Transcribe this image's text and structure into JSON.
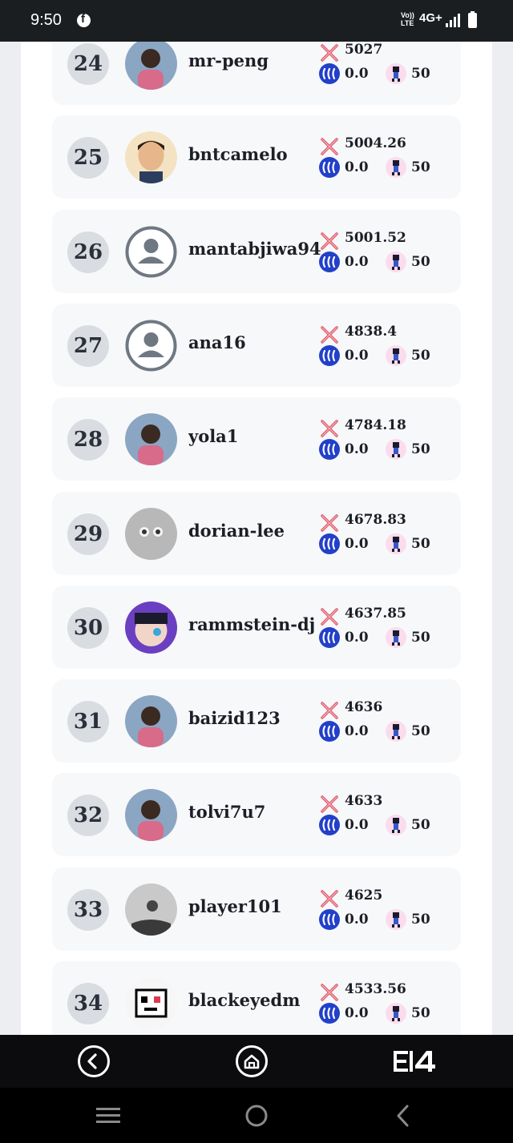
{
  "status_bar": {
    "time": "9:50",
    "volte_line1": "Vo))",
    "volte_line2": "LTE",
    "network": "4G+",
    "icons": [
      "facebook-icon",
      "signal-icon",
      "battery-icon"
    ]
  },
  "colors": {
    "rank_badge": "#d9dce1",
    "steem_icon": "#2340c9",
    "swords_icon": "#e05a6a",
    "card_bg": "#f7f8fa"
  },
  "leaderboard": [
    {
      "rank": "24",
      "username": "mr-peng",
      "score": "5027",
      "steem": "0.0",
      "level": "50",
      "avatar": "photo"
    },
    {
      "rank": "25",
      "username": "bntcamelo",
      "score": "5004.26",
      "steem": "0.0",
      "level": "50",
      "avatar": "cartoon"
    },
    {
      "rank": "26",
      "username": "mantabjiwa94",
      "score": "5001.52",
      "steem": "0.0",
      "level": "50",
      "avatar": "default"
    },
    {
      "rank": "27",
      "username": "ana16",
      "score": "4838.4",
      "steem": "0.0",
      "level": "50",
      "avatar": "default"
    },
    {
      "rank": "28",
      "username": "yola1",
      "score": "4784.18",
      "steem": "0.0",
      "level": "50",
      "avatar": "photo"
    },
    {
      "rank": "29",
      "username": "dorian-lee",
      "score": "4678.83",
      "steem": "0.0",
      "level": "50",
      "avatar": "cat"
    },
    {
      "rank": "30",
      "username": "rammstein-dj",
      "score": "4637.85",
      "steem": "0.0",
      "level": "50",
      "avatar": "anime"
    },
    {
      "rank": "31",
      "username": "baizid123",
      "score": "4636",
      "steem": "0.0",
      "level": "50",
      "avatar": "photo"
    },
    {
      "rank": "32",
      "username": "tolvi7u7",
      "score": "4633",
      "steem": "0.0",
      "level": "50",
      "avatar": "photo"
    },
    {
      "rank": "33",
      "username": "player101",
      "score": "4625",
      "steem": "0.0",
      "level": "50",
      "avatar": "photo-bw"
    },
    {
      "rank": "34",
      "username": "blackeyedm",
      "score": "4533.56",
      "steem": "0.0",
      "level": "50",
      "avatar": "pixel"
    }
  ],
  "app_nav": {
    "icons": [
      "back-icon",
      "home-icon",
      "app-logo-icon"
    ]
  },
  "system_nav": {
    "icons": [
      "recents-icon",
      "home-circle-icon",
      "back-chevron-icon"
    ]
  }
}
